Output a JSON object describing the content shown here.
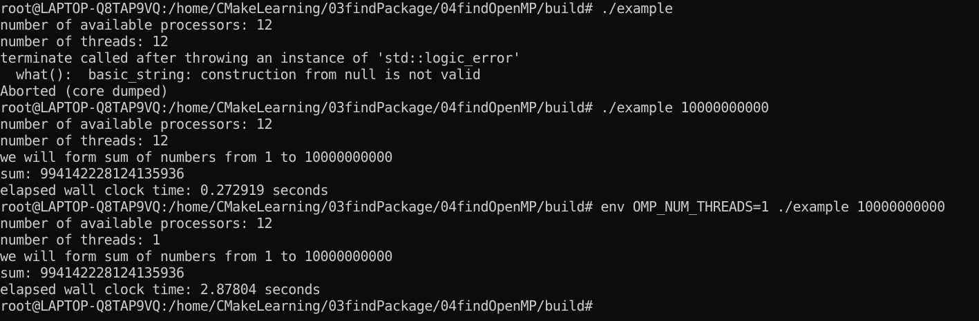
{
  "terminal": {
    "lines": [
      "root@LAPTOP-Q8TAP9VQ:/home/CMakeLearning/03findPackage/04findOpenMP/build# ./example",
      "number of available processors: 12",
      "number of threads: 12",
      "terminate called after throwing an instance of 'std::logic_error'",
      "  what():  basic_string: construction from null is not valid",
      "Aborted (core dumped)",
      "root@LAPTOP-Q8TAP9VQ:/home/CMakeLearning/03findPackage/04findOpenMP/build# ./example 10000000000",
      "number of available processors: 12",
      "number of threads: 12",
      "we will form sum of numbers from 1 to 10000000000",
      "sum: 994142228124135936",
      "elapsed wall clock time: 0.272919 seconds",
      "root@LAPTOP-Q8TAP9VQ:/home/CMakeLearning/03findPackage/04findOpenMP/build# env OMP_NUM_THREADS=1 ./example 10000000000",
      "number of available processors: 12",
      "number of threads: 1",
      "we will form sum of numbers from 1 to 10000000000",
      "sum: 994142228124135936",
      "elapsed wall clock time: 2.87804 seconds",
      "root@LAPTOP-Q8TAP9VQ:/home/CMakeLearning/03findPackage/04findOpenMP/build#"
    ]
  }
}
